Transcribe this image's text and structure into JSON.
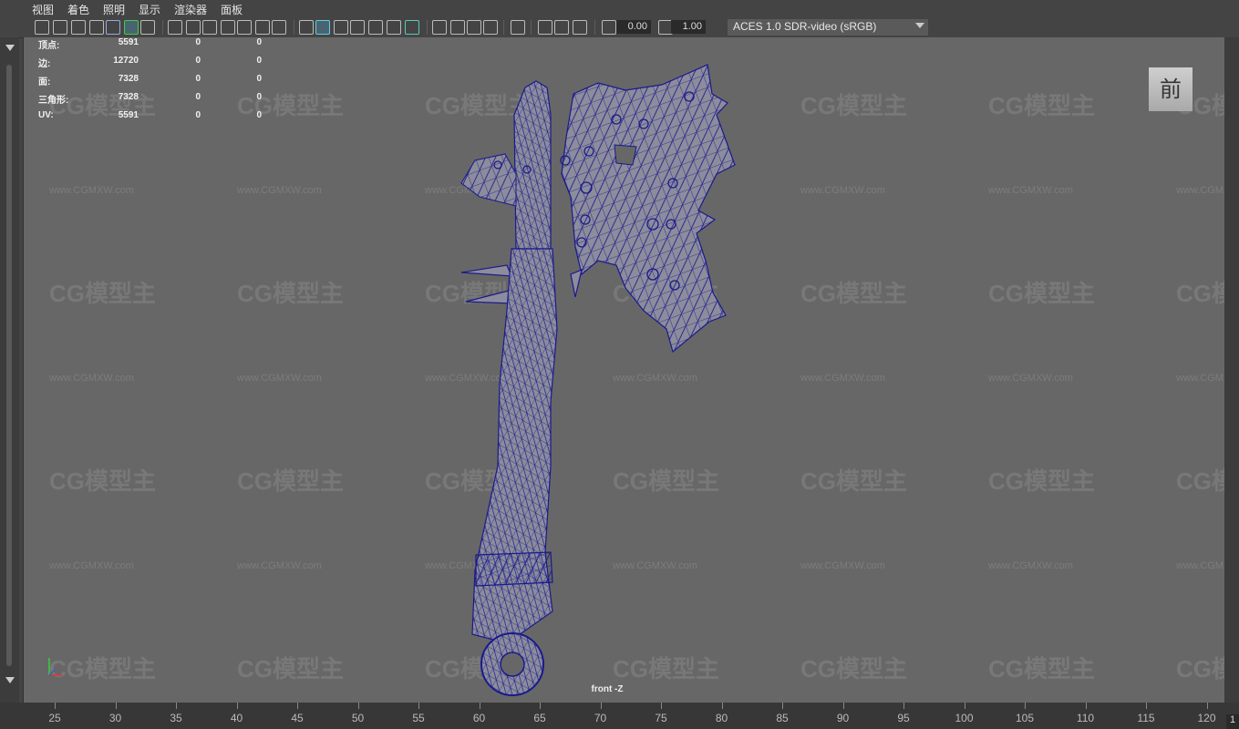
{
  "menu": [
    "视图",
    "着色",
    "照明",
    "显示",
    "渲染器",
    "面板"
  ],
  "toolbar": {
    "exposure": "0.00",
    "gamma": "1.00",
    "color_management": "ACES 1.0 SDR-video (sRGB)",
    "icons": [
      "camera-icon",
      "camera-attributes-icon",
      "bookmark-icon",
      "image-plane-icon",
      "2d-pan-zoom-icon",
      "grease-pencil-icon",
      "grid-icon",
      "film-gate-icon",
      "resolution-gate-icon",
      "gate-mask-icon",
      "field-chart-icon",
      "safe-action-icon",
      "safe-title-icon",
      "wireframe-icon",
      "smooth-shade-icon",
      "default-material-icon",
      "wireframe-on-shaded-icon",
      "textured-icon",
      "lighting-icon",
      "shadows-icon",
      "screen-space-ao-icon",
      "motion-blur-icon",
      "anti-aliasing-icon",
      "depth-of-field-icon",
      "isolate-select-icon",
      "xray-icon",
      "xray-joints-icon",
      "backface-culling-icon",
      "exposure-icon",
      "gamma-icon",
      "color-management-icon"
    ]
  },
  "hud": {
    "rows": [
      {
        "label": "顶点:",
        "values": [
          "5591",
          "0",
          "0"
        ]
      },
      {
        "label": "边:",
        "values": [
          "12720",
          "0",
          "0"
        ]
      },
      {
        "label": "面:",
        "values": [
          "7328",
          "0",
          "0"
        ]
      },
      {
        "label": "三角形:",
        "values": [
          "7328",
          "0",
          "0"
        ]
      },
      {
        "label": "UV:",
        "values": [
          "5591",
          "0",
          "0"
        ]
      }
    ]
  },
  "view_cube_label": "前",
  "camera_label": "front -Z",
  "watermark": {
    "text": "CG模型主",
    "url": "www.CGMXW.com"
  },
  "timeline": {
    "ticks": [
      "25",
      "30",
      "35",
      "40",
      "45",
      "50",
      "55",
      "60",
      "65",
      "70",
      "75",
      "80",
      "85",
      "90",
      "95",
      "100",
      "105",
      "110",
      "115",
      "120"
    ],
    "current_frame": "1"
  },
  "colors": {
    "wireframe": "#1a1a8c",
    "mesh_fill": "#8a8a9a",
    "viewport_bg": "#676767"
  }
}
